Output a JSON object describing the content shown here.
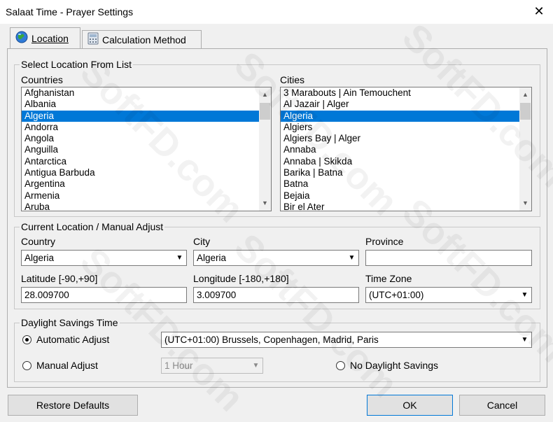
{
  "window": {
    "title": "Salaat Time - Prayer Settings",
    "close_glyph": "✕"
  },
  "tabs": [
    {
      "label": "Location",
      "icon": "globe-icon"
    },
    {
      "label": "Calculation Method",
      "icon": "calculator-icon"
    }
  ],
  "select_location": {
    "legend": "Select Location From List",
    "countries_label": "Countries",
    "cities_label": "Cities",
    "countries": [
      "Afghanistan",
      "Albania",
      "Algeria",
      "Andorra",
      "Angola",
      "Anguilla",
      "Antarctica",
      "Antigua Barbuda",
      "Argentina",
      "Armenia",
      "Aruba"
    ],
    "countries_selected": "Algeria",
    "cities": [
      "3 Marabouts | Ain Temouchent",
      "Al Jazair | Alger",
      "Algeria",
      "Algiers",
      "Algiers Bay | Alger",
      "Annaba",
      "Annaba | Skikda",
      "Barika | Batna",
      "Batna",
      "Bejaia",
      "Bir el Ater"
    ],
    "cities_selected": "Algeria"
  },
  "current_location": {
    "legend": "Current Location / Manual Adjust",
    "country_label": "Country",
    "country_value": "Algeria",
    "city_label": "City",
    "city_value": "Algeria",
    "province_label": "Province",
    "province_value": "",
    "latitude_label": "Latitude [-90,+90]",
    "latitude_value": "28.009700",
    "longitude_label": "Longitude [-180,+180]",
    "longitude_value": "3.009700",
    "timezone_label": "Time Zone",
    "timezone_value": "(UTC+01:00)"
  },
  "daylight": {
    "legend": "Daylight Savings Time",
    "automatic_label": "Automatic Adjust",
    "automatic_zone": "(UTC+01:00) Brussels, Copenhagen, Madrid, Paris",
    "manual_label": "Manual Adjust",
    "manual_value": "1 Hour",
    "none_label": "No Daylight Savings",
    "selected": "automatic"
  },
  "buttons": {
    "restore": "Restore Defaults",
    "ok": "OK",
    "cancel": "Cancel"
  },
  "watermark": "SoftFD.com",
  "colors": {
    "selection": "#0078d7"
  }
}
